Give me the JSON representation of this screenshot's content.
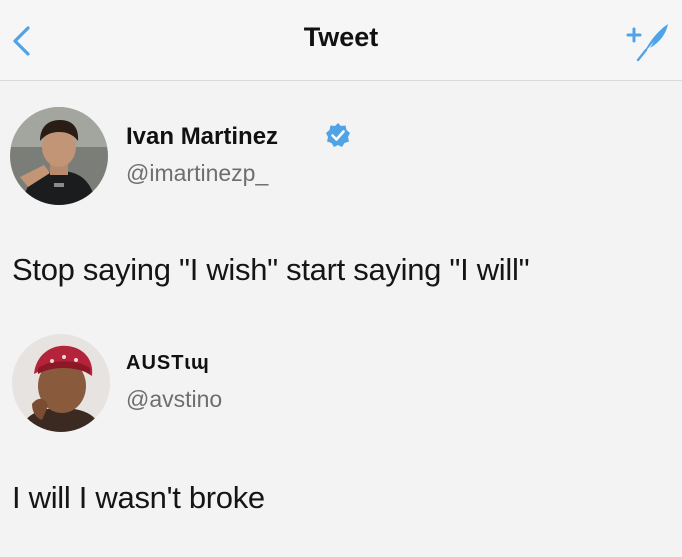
{
  "header": {
    "title": "Tweet",
    "back_icon": "chevron-left-icon",
    "compose_icon": "compose-tweet-icon",
    "accent": "#4fa3e6"
  },
  "tweet": {
    "author_name": "Ivan Martinez",
    "author_handle": "@imartinezp_",
    "verified": true,
    "text": "Stop saying \"I wish\" start saying \"I will\""
  },
  "reply": {
    "author_name": "AUSTɩɰ",
    "author_handle": "@avstino",
    "text": "I will I wasn't broke"
  }
}
